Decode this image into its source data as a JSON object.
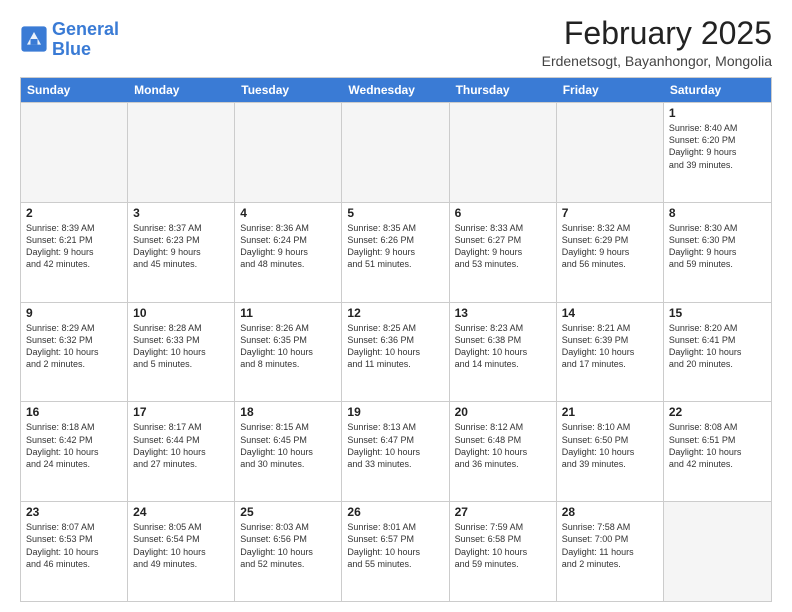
{
  "logo": {
    "line1": "General",
    "line2": "Blue"
  },
  "title": "February 2025",
  "subtitle": "Erdenetsogt, Bayanhongor, Mongolia",
  "days": [
    "Sunday",
    "Monday",
    "Tuesday",
    "Wednesday",
    "Thursday",
    "Friday",
    "Saturday"
  ],
  "rows": [
    [
      {
        "day": "",
        "empty": true
      },
      {
        "day": "",
        "empty": true
      },
      {
        "day": "",
        "empty": true
      },
      {
        "day": "",
        "empty": true
      },
      {
        "day": "",
        "empty": true
      },
      {
        "day": "",
        "empty": true
      },
      {
        "day": "1",
        "info": "Sunrise: 8:40 AM\nSunset: 6:20 PM\nDaylight: 9 hours\nand 39 minutes."
      }
    ],
    [
      {
        "day": "2",
        "info": "Sunrise: 8:39 AM\nSunset: 6:21 PM\nDaylight: 9 hours\nand 42 minutes."
      },
      {
        "day": "3",
        "info": "Sunrise: 8:37 AM\nSunset: 6:23 PM\nDaylight: 9 hours\nand 45 minutes."
      },
      {
        "day": "4",
        "info": "Sunrise: 8:36 AM\nSunset: 6:24 PM\nDaylight: 9 hours\nand 48 minutes."
      },
      {
        "day": "5",
        "info": "Sunrise: 8:35 AM\nSunset: 6:26 PM\nDaylight: 9 hours\nand 51 minutes."
      },
      {
        "day": "6",
        "info": "Sunrise: 8:33 AM\nSunset: 6:27 PM\nDaylight: 9 hours\nand 53 minutes."
      },
      {
        "day": "7",
        "info": "Sunrise: 8:32 AM\nSunset: 6:29 PM\nDaylight: 9 hours\nand 56 minutes."
      },
      {
        "day": "8",
        "info": "Sunrise: 8:30 AM\nSunset: 6:30 PM\nDaylight: 9 hours\nand 59 minutes."
      }
    ],
    [
      {
        "day": "9",
        "info": "Sunrise: 8:29 AM\nSunset: 6:32 PM\nDaylight: 10 hours\nand 2 minutes."
      },
      {
        "day": "10",
        "info": "Sunrise: 8:28 AM\nSunset: 6:33 PM\nDaylight: 10 hours\nand 5 minutes."
      },
      {
        "day": "11",
        "info": "Sunrise: 8:26 AM\nSunset: 6:35 PM\nDaylight: 10 hours\nand 8 minutes."
      },
      {
        "day": "12",
        "info": "Sunrise: 8:25 AM\nSunset: 6:36 PM\nDaylight: 10 hours\nand 11 minutes."
      },
      {
        "day": "13",
        "info": "Sunrise: 8:23 AM\nSunset: 6:38 PM\nDaylight: 10 hours\nand 14 minutes."
      },
      {
        "day": "14",
        "info": "Sunrise: 8:21 AM\nSunset: 6:39 PM\nDaylight: 10 hours\nand 17 minutes."
      },
      {
        "day": "15",
        "info": "Sunrise: 8:20 AM\nSunset: 6:41 PM\nDaylight: 10 hours\nand 20 minutes."
      }
    ],
    [
      {
        "day": "16",
        "info": "Sunrise: 8:18 AM\nSunset: 6:42 PM\nDaylight: 10 hours\nand 24 minutes."
      },
      {
        "day": "17",
        "info": "Sunrise: 8:17 AM\nSunset: 6:44 PM\nDaylight: 10 hours\nand 27 minutes."
      },
      {
        "day": "18",
        "info": "Sunrise: 8:15 AM\nSunset: 6:45 PM\nDaylight: 10 hours\nand 30 minutes."
      },
      {
        "day": "19",
        "info": "Sunrise: 8:13 AM\nSunset: 6:47 PM\nDaylight: 10 hours\nand 33 minutes."
      },
      {
        "day": "20",
        "info": "Sunrise: 8:12 AM\nSunset: 6:48 PM\nDaylight: 10 hours\nand 36 minutes."
      },
      {
        "day": "21",
        "info": "Sunrise: 8:10 AM\nSunset: 6:50 PM\nDaylight: 10 hours\nand 39 minutes."
      },
      {
        "day": "22",
        "info": "Sunrise: 8:08 AM\nSunset: 6:51 PM\nDaylight: 10 hours\nand 42 minutes."
      }
    ],
    [
      {
        "day": "23",
        "info": "Sunrise: 8:07 AM\nSunset: 6:53 PM\nDaylight: 10 hours\nand 46 minutes."
      },
      {
        "day": "24",
        "info": "Sunrise: 8:05 AM\nSunset: 6:54 PM\nDaylight: 10 hours\nand 49 minutes."
      },
      {
        "day": "25",
        "info": "Sunrise: 8:03 AM\nSunset: 6:56 PM\nDaylight: 10 hours\nand 52 minutes."
      },
      {
        "day": "26",
        "info": "Sunrise: 8:01 AM\nSunset: 6:57 PM\nDaylight: 10 hours\nand 55 minutes."
      },
      {
        "day": "27",
        "info": "Sunrise: 7:59 AM\nSunset: 6:58 PM\nDaylight: 10 hours\nand 59 minutes."
      },
      {
        "day": "28",
        "info": "Sunrise: 7:58 AM\nSunset: 7:00 PM\nDaylight: 11 hours\nand 2 minutes."
      },
      {
        "day": "",
        "empty": true
      }
    ]
  ]
}
